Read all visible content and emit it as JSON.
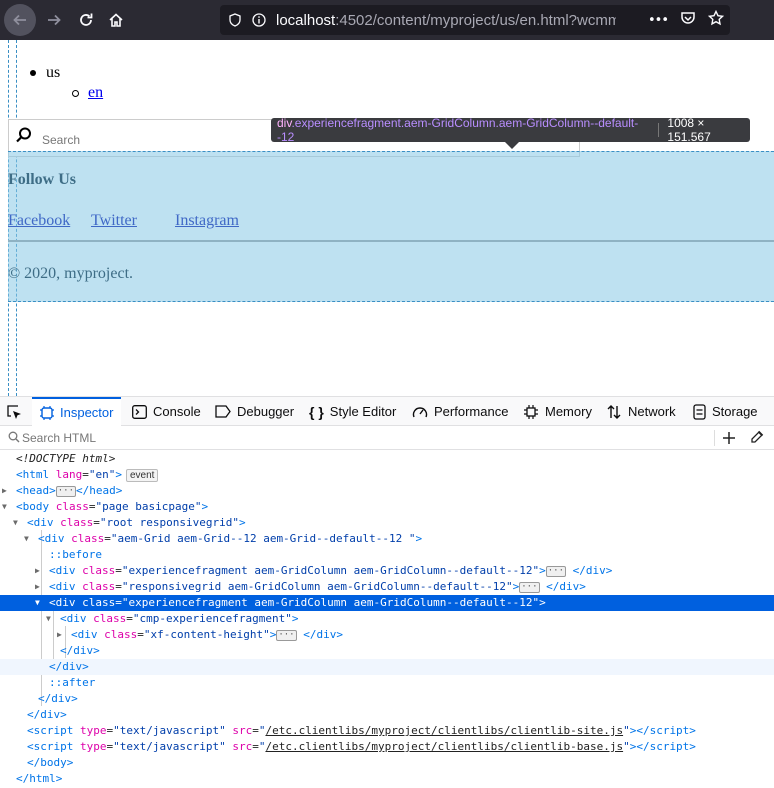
{
  "browser": {
    "url_host": "localhost",
    "url_rest": ":4502/content/myproject/us/en.html?wcmm",
    "more_label": "•••"
  },
  "page": {
    "nav_level1": "us",
    "nav_level2": "en",
    "search_placeholder": "Search",
    "follow_us": "Follow Us",
    "social": [
      "Facebook",
      "Twitter",
      "Instagram"
    ],
    "copyright": "© 2020, myproject."
  },
  "tooltip": {
    "tag": "div",
    "classes": ".experiencefragment.aem-GridColumn.aem-GridColumn--default--12",
    "dimensions": "1008 × 151.567"
  },
  "devtools": {
    "tabs": [
      "Inspector",
      "Console",
      "Debugger",
      "Style Editor",
      "Performance",
      "Memory",
      "Network",
      "Storage"
    ],
    "active_tab": "Inspector",
    "search_placeholder": "Search HTML",
    "tree": [
      {
        "indent": 0,
        "tw": "",
        "html": "<span class='cm'>&lt;!DOCTYPE html&gt;</span>"
      },
      {
        "indent": 0,
        "tw": "",
        "html": "<span class='tg'>&lt;html</span> <span class='at'>lang</span>=<span class='av'>\"en\"</span><span class='tg'>&gt;</span><span class='evt'>event</span>"
      },
      {
        "indent": 0,
        "tw": "▶",
        "html": "<span class='tg'>&lt;head&gt;</span><span class='ell'>···</span><span class='tg'>&lt;/head&gt;</span>"
      },
      {
        "indent": 0,
        "tw": "▼",
        "html": "<span class='tg'>&lt;body</span> <span class='at'>class</span>=<span class='av'>\"page basicpage\"</span><span class='tg'>&gt;</span>"
      },
      {
        "indent": 1,
        "tw": "▼",
        "html": "<span class='tg'>&lt;div</span> <span class='at'>class</span>=<span class='av'>\"root responsivegrid\"</span><span class='tg'>&gt;</span>"
      },
      {
        "indent": 2,
        "tw": "▼",
        "html": "<span class='tg'>&lt;div</span> <span class='at'>class</span>=<span class='av'>\"aem-Grid aem-Grid--12 aem-Grid--default--12 \"</span><span class='tg'>&gt;</span>"
      },
      {
        "indent": 3,
        "tw": "",
        "html": "<span class='pc'>::before</span>"
      },
      {
        "indent": 3,
        "tw": "▶",
        "html": "<span class='tg'>&lt;div</span> <span class='at'>class</span>=<span class='av'>\"experiencefragment aem-GridColumn aem-GridColumn--default--12\"</span><span class='tg'>&gt;</span><span class='ell'>···</span> <span class='tg'>&lt;/div&gt;</span>"
      },
      {
        "indent": 3,
        "tw": "▶",
        "html": "<span class='tg'>&lt;div</span> <span class='at'>class</span>=<span class='av'>\"responsivegrid aem-GridColumn aem-GridColumn--default--12\"</span><span class='tg'>&gt;</span><span class='ell'>···</span> <span class='tg'>&lt;/div&gt;</span>"
      },
      {
        "indent": 3,
        "tw": "▼",
        "html": "<span class='tg'>&lt;div</span> <span class='at'>class</span>=<span class='av'>\"experiencefragment aem-GridColumn aem-GridColumn--default--12\"</span><span class='tg'>&gt;</span>",
        "selected": true
      },
      {
        "indent": 4,
        "tw": "▼",
        "html": "<span class='tg'>&lt;div</span> <span class='at'>class</span>=<span class='av'>\"cmp-experiencefragment\"</span><span class='tg'>&gt;</span>"
      },
      {
        "indent": 5,
        "tw": "▶",
        "html": "<span class='tg'>&lt;div</span> <span class='at'>class</span>=<span class='av'>\"xf-content-height\"</span><span class='tg'>&gt;</span><span class='ell'>···</span> <span class='tg'>&lt;/div&gt;</span>"
      },
      {
        "indent": 4,
        "tw": "",
        "html": "<span class='tg'>&lt;/div&gt;</span>"
      },
      {
        "indent": 3,
        "tw": "",
        "html": "<span class='tg'>&lt;/div&gt;</span>",
        "hover": true
      },
      {
        "indent": 3,
        "tw": "",
        "html": "<span class='pc'>::after</span>"
      },
      {
        "indent": 2,
        "tw": "",
        "html": "<span class='tg'>&lt;/div&gt;</span>"
      },
      {
        "indent": 1,
        "tw": "",
        "html": "<span class='tg'>&lt;/div&gt;</span>"
      },
      {
        "indent": 1,
        "tw": "",
        "html": "<span class='tg'>&lt;script</span> <span class='at'>type</span>=<span class='av'>\"text/javascript\"</span> <span class='at'>src</span>=<span class='av'>\"<span class='lnk'>/etc.clientlibs/myproject/clientlibs/clientlib-site.js</span>\"</span><span class='tg'>&gt;&lt;/script&gt;</span>"
      },
      {
        "indent": 1,
        "tw": "",
        "html": "<span class='tg'>&lt;script</span> <span class='at'>type</span>=<span class='av'>\"text/javascript\"</span> <span class='at'>src</span>=<span class='av'>\"<span class='lnk'>/etc.clientlibs/myproject/clientlibs/clientlib-base.js</span>\"</span><span class='tg'>&gt;&lt;/script&gt;</span>"
      },
      {
        "indent": 1,
        "tw": "",
        "html": "<span class='tg'>&lt;/body&gt;</span>"
      },
      {
        "indent": 0,
        "tw": "",
        "html": "<span class='tg'>&lt;/html&gt;</span>"
      }
    ]
  }
}
